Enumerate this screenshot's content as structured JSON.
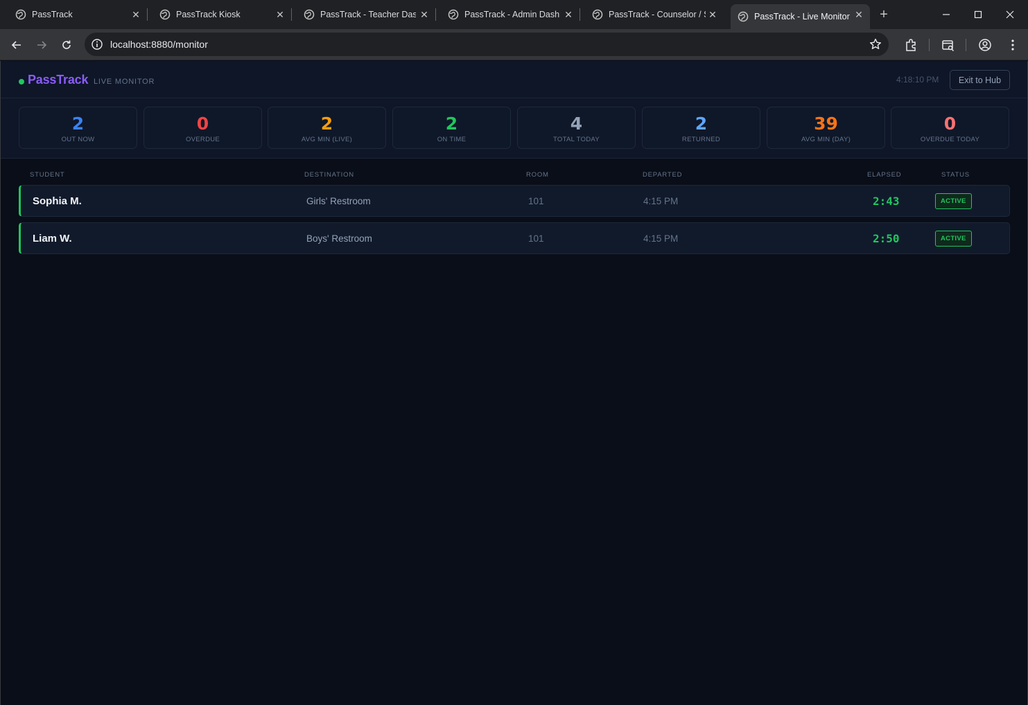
{
  "browser": {
    "tabs": [
      {
        "title": "PassTrack",
        "active": false
      },
      {
        "title": "PassTrack Kiosk",
        "active": false
      },
      {
        "title": "PassTrack - Teacher Dashb",
        "active": false
      },
      {
        "title": "PassTrack - Admin Dashbo",
        "active": false
      },
      {
        "title": "PassTrack - Counselor / St",
        "active": false
      },
      {
        "title": "PassTrack - Live Monitor",
        "active": true
      }
    ],
    "url": "localhost:8880/monitor"
  },
  "header": {
    "brand": "PassTrack",
    "subtitle": "LIVE MONITOR",
    "clock": "4:18:10 PM",
    "exit_label": "Exit to Hub"
  },
  "stats": [
    {
      "value": "2",
      "label": "OUT NOW",
      "color": "#3b82f6"
    },
    {
      "value": "0",
      "label": "OVERDUE",
      "color": "#ef4444"
    },
    {
      "value": "2",
      "label": "AVG MIN (LIVE)",
      "color": "#f59e0b"
    },
    {
      "value": "2",
      "label": "ON TIME",
      "color": "#22c55e"
    },
    {
      "value": "4",
      "label": "TOTAL TODAY",
      "color": "#94a3b8"
    },
    {
      "value": "2",
      "label": "RETURNED",
      "color": "#60a5fa"
    },
    {
      "value": "39",
      "label": "AVG MIN (DAY)",
      "color": "#f97316"
    },
    {
      "value": "0",
      "label": "OVERDUE TODAY",
      "color": "#f87171"
    }
  ],
  "table": {
    "columns": {
      "student": "STUDENT",
      "destination": "DESTINATION",
      "room": "ROOM",
      "departed": "DEPARTED",
      "elapsed": "ELAPSED",
      "status": "STATUS"
    },
    "rows": [
      {
        "student": "Sophia M.",
        "destination": "Girls' Restroom",
        "room": "101",
        "departed": "4:15 PM",
        "elapsed": "2:43",
        "status": "ACTIVE"
      },
      {
        "student": "Liam W.",
        "destination": "Boys' Restroom",
        "room": "101",
        "departed": "4:15 PM",
        "elapsed": "2:50",
        "status": "ACTIVE"
      }
    ]
  },
  "colors": {
    "accent": "#8b5cf6",
    "active": "#22c55e",
    "background": "#0a0e18"
  }
}
